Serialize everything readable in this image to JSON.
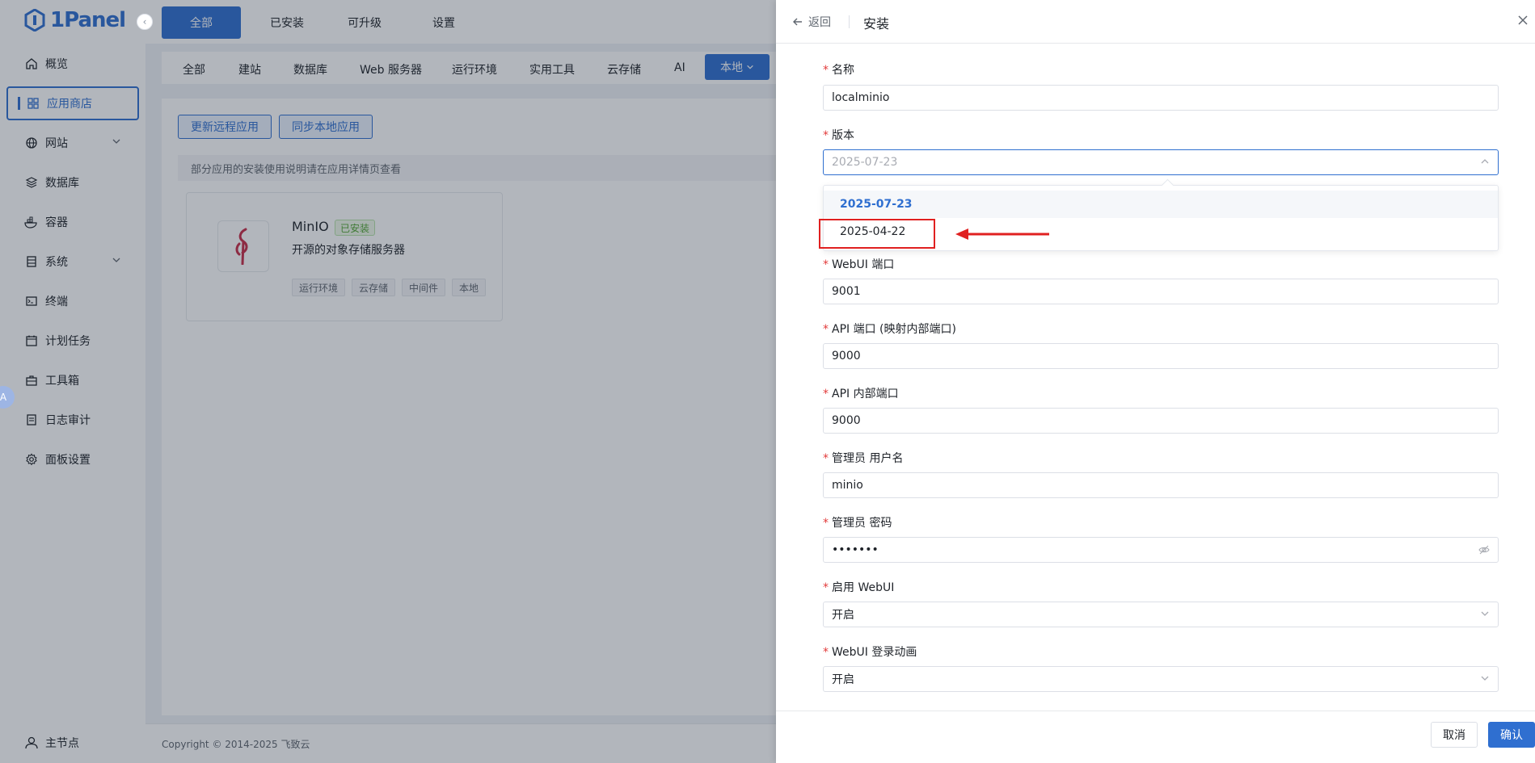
{
  "colors": {
    "accent": "#2f6fd0",
    "danger": "#e02020",
    "success": "#52a534"
  },
  "sidebar": {
    "logo": "1Panel",
    "items": [
      {
        "label": "概览",
        "icon": "home-icon"
      },
      {
        "label": "应用商店",
        "icon": "grid-icon"
      },
      {
        "label": "网站",
        "icon": "globe-icon"
      },
      {
        "label": "数据库",
        "icon": "layers-icon"
      },
      {
        "label": "容器",
        "icon": "docker-icon"
      },
      {
        "label": "系统",
        "icon": "server-icon"
      },
      {
        "label": "终端",
        "icon": "terminal-icon"
      },
      {
        "label": "计划任务",
        "icon": "calendar-icon"
      },
      {
        "label": "工具箱",
        "icon": "toolbox-icon"
      },
      {
        "label": "日志审计",
        "icon": "log-icon"
      },
      {
        "label": "面板设置",
        "icon": "gear-icon"
      }
    ],
    "bottom": "主节点",
    "badge": "A"
  },
  "top_tabs": [
    "全部",
    "已安装",
    "可升级",
    "设置"
  ],
  "categories": [
    "全部",
    "建站",
    "数据库",
    "Web 服务器",
    "运行环境",
    "实用工具",
    "云存储",
    "AI"
  ],
  "local_button": "本地",
  "actions": {
    "update_remote": "更新远程应用",
    "sync_local": "同步本地应用"
  },
  "notice": "部分应用的安装使用说明请在应用详情页查看",
  "app_card": {
    "name": "MinIO",
    "status": "已安装",
    "description": "开源的对象存储服务器",
    "tags": [
      "运行环境",
      "云存储",
      "中间件",
      "本地"
    ]
  },
  "footer": "Copyright © 2014-2025 飞致云",
  "drawer": {
    "back": "返回",
    "title": "安装",
    "fields": {
      "name": {
        "label": "名称",
        "value": "localminio"
      },
      "version": {
        "label": "版本",
        "placeholder": "2025-07-23",
        "options": [
          "2025-07-23",
          "2025-04-22"
        ]
      },
      "webui_port": {
        "label": "WebUI 端口",
        "value": "9001"
      },
      "api_port": {
        "label": "API 端口 (映射内部端口)",
        "value": "9000"
      },
      "api_internal_port": {
        "label": "API 内部端口",
        "value": "9000"
      },
      "admin_user": {
        "label": "管理员 用户名",
        "value": "minio"
      },
      "admin_password": {
        "label": "管理员 密码",
        "value": "•••••••"
      },
      "enable_webui": {
        "label": "启用 WebUI",
        "value": "开启"
      },
      "webui_animation": {
        "label": "WebUI 登录动画",
        "value": "开启"
      }
    },
    "cancel": "取消",
    "confirm": "确认"
  }
}
